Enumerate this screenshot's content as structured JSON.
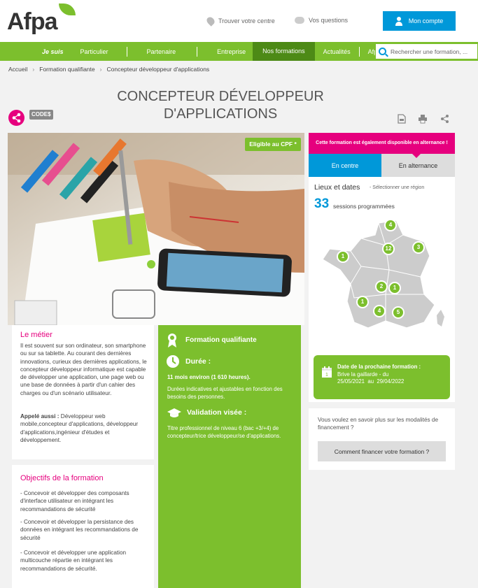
{
  "header": {
    "logo_text": "Afpa",
    "find_center": "Trouver votre centre",
    "questions": "Vos questions",
    "account_button": "Mon compte"
  },
  "nav": {
    "items": [
      "Je suis",
      "Particulier",
      "Partenaire",
      "Entreprise",
      "Nos formations",
      "Actualités",
      "Afpa"
    ],
    "active": "Nos formations",
    "search_placeholder": "Rechercher une formation, ..."
  },
  "breadcrumb": [
    "Accueil",
    "Formation qualifiante",
    "Concepteur développeur d'applications"
  ],
  "page": {
    "title_line1": "CONCEPTEUR DÉVELOPPEUR",
    "title_line2": "D'APPLICATIONS",
    "codes_badge": "CODE$",
    "cpf_badge": "Eligible au CPF *"
  },
  "metier": {
    "heading": "Le métier",
    "paragraph": "Il est souvent sur son ordinateur, son smartphone ou sur sa tablette. Au courant des dernières innovations, curieux des dernières applications, le concepteur développeur informatique est capable de développer une application, une page web ou une base de données à partir d'un cahier des charges ou d'un scénario utilisateur.",
    "aussi_label": "Appelé aussi :",
    "aussi_text": "Développeur web mobile,concepteur d'applications, développeur d'applications,ingénieur d'études et développement."
  },
  "objectifs": {
    "heading": "Objectifs de la formation",
    "items": [
      "- Concevoir et développer des composants d'interface utilisateur en intégrant les recommandations de sécurité",
      "- Concevoir et développer la persistance des données en intégrant les recommandations de sécurité",
      "- Concevoir et développer une application multicouche répartie en intégrant les recommandations de sécurité."
    ]
  },
  "info": {
    "type_label": "Formation qualifiante",
    "duree_label": "Durée :",
    "duree_value": "11 mois environ (1 610 heures).",
    "duree_note": "Durées indicatives et ajustables en fonction des besoins des personnes.",
    "validation_label": "Validation visée :",
    "validation_text": "Titre professionnel de niveau 6 (bac +3/+4) de concepteur/trice développeur/se d'applications."
  },
  "sidebar": {
    "banner": "Cette formation est également disponible en alternance !",
    "tab_centre": "En centre",
    "tab_alternance": "En alternance",
    "lieux_title": "Lieux et dates",
    "lieux_hint": "- Sélectionner une région",
    "sessions_count": "33",
    "sessions_label": "sessions programmées",
    "map_markers": [
      "4",
      "12",
      "3",
      "1",
      "2",
      "1",
      "1",
      "4",
      "5"
    ],
    "next_title": "Date de la prochaine formation :",
    "next_place": "Brive la gaillarde - du",
    "next_dates": "25/05/2021  au  29/04/2022",
    "calendar_day": "1",
    "financing_question": "Vous voulez en savoir plus sur les modalités de financement ?",
    "financing_button": "Comment financer votre formation ?"
  },
  "colors": {
    "green": "#7cbf2d",
    "pink": "#e6007e",
    "blue": "#0098d9"
  }
}
